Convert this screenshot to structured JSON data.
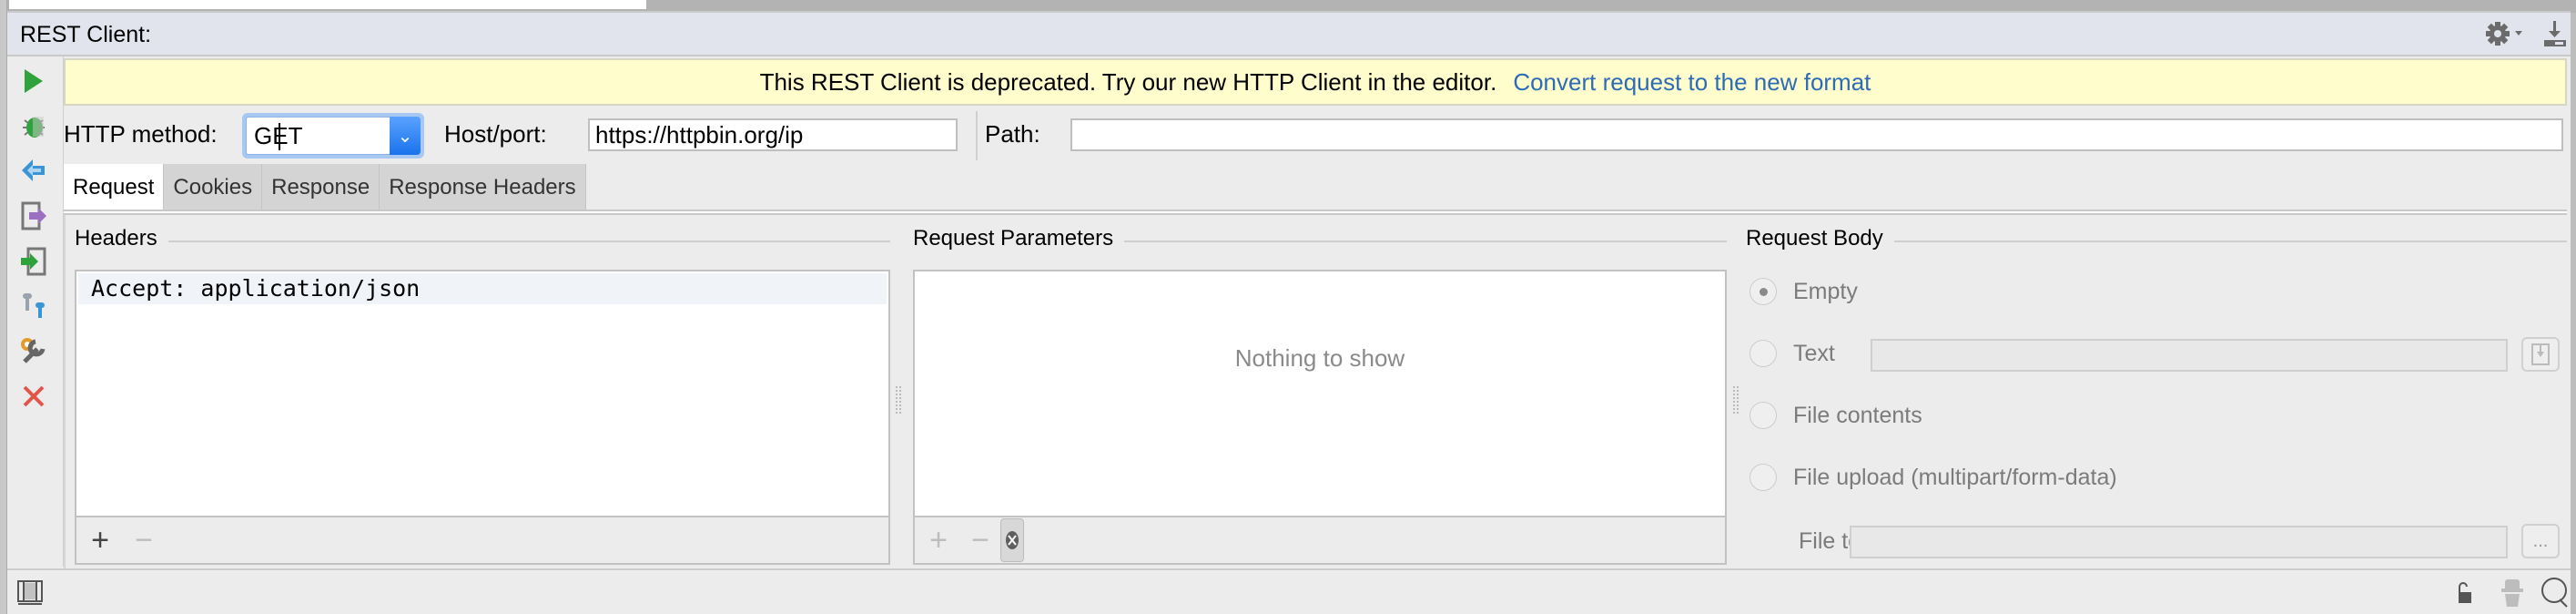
{
  "window": {
    "title": "REST Client:"
  },
  "header_actions": [
    {
      "name": "settings",
      "icon": "gear-icon"
    },
    {
      "name": "hide",
      "icon": "download-hide-icon"
    }
  ],
  "toolbar": [
    {
      "name": "run",
      "icon": "run-icon",
      "color": "#2ea33c"
    },
    {
      "name": "debug",
      "icon": "bug-icon",
      "color": "#2ea33c"
    },
    {
      "name": "replay",
      "icon": "back-arrow-icon",
      "color": "#3a95d6"
    },
    {
      "name": "export",
      "icon": "export-request-icon",
      "color": "#9b6fc1"
    },
    {
      "name": "import",
      "icon": "import-request-icon",
      "color": "#2ea33c"
    },
    {
      "name": "auth",
      "icon": "keys-icon",
      "color": "#3a95d6"
    },
    {
      "name": "settings",
      "icon": "tools-icon",
      "color": "#e49a2b"
    },
    {
      "name": "close",
      "icon": "close-icon",
      "color": "#e0574a"
    }
  ],
  "banner": {
    "message": "This REST Client is deprecated. Try our new HTTP Client in the editor.",
    "link": "Convert request to the new format",
    "link_color": "#2c6bb5"
  },
  "request": {
    "method_label": "HTTP method:",
    "method_value": "GET",
    "host_label": "Host/port:",
    "host_value": "https://httpbin.org/ip",
    "path_label": "Path:",
    "path_value": ""
  },
  "tabs": [
    {
      "label": "Request",
      "active": true
    },
    {
      "label": "Cookies",
      "active": false
    },
    {
      "label": "Response",
      "active": false
    },
    {
      "label": "Response Headers",
      "active": false
    }
  ],
  "headers_panel": {
    "title": "Headers",
    "rows": [
      "Accept: application/json"
    ],
    "add_label": "+",
    "remove_label": "−"
  },
  "params_panel": {
    "title": "Request Parameters",
    "empty_text": "Nothing to show",
    "add_label": "+",
    "remove_label": "−",
    "clear_label": "✕"
  },
  "body_panel": {
    "title": "Request Body",
    "options": [
      {
        "label": "Empty",
        "selected": true
      },
      {
        "label": "Text",
        "selected": false
      },
      {
        "label": "File contents",
        "selected": false
      },
      {
        "label": "File upload (multipart/form-data)",
        "selected": false
      }
    ],
    "file_to_send_label": "File to send:",
    "file_to_send_value": "",
    "browse_label": "..."
  }
}
